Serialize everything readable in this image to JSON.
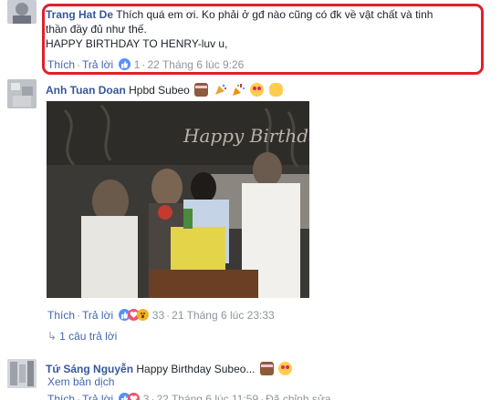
{
  "comment1": {
    "author": "Trang Hat De",
    "text_line1": "Thích quá em ơi. Ko phải ở gđ nào cũng có đk về vật chất và tinh",
    "text_line2": "thần đầy đủ như thế.",
    "text_line3": "HAPPY BIRTHDAY TO HENRY-luv u,",
    "like_label": "Thích",
    "reply_label": "Trả lời",
    "reaction_count": "1",
    "timestamp": "22 Tháng 6 lúc 9:26"
  },
  "comment2": {
    "author": "Anh Tuan Doan",
    "text": "Hpbd Subeo",
    "like_label": "Thích",
    "reply_label": "Trả lời",
    "reaction_count": "33",
    "timestamp": "21 Tháng 6 lúc 23:33",
    "photo_banner_text": "Happy Birthday",
    "replies_label": "1 câu trả lời"
  },
  "comment3": {
    "author": "Tứ Sáng Nguyễn",
    "text": "Happy Birthday Subeo...",
    "see_translation": "Xem bản dịch",
    "like_label": "Thích",
    "reply_label": "Trả lời",
    "reaction_count": "3",
    "timestamp": "22 Tháng 6 lúc 11:59",
    "edited_label": "Đã chỉnh sửa"
  },
  "icons": {
    "emoji": [
      "birthday-cake",
      "party-popper",
      "confetti",
      "heart-eyes-face",
      "raising-hands",
      "birthday-cake",
      "heart-eyes-face"
    ],
    "reactions": [
      "like",
      "love",
      "wow"
    ]
  },
  "colors": {
    "link": "#365899",
    "action_link": "#4267b2",
    "highlight_border": "#e0202a",
    "like": "#5890ff",
    "love": "#f25268",
    "wow": "#f7b125"
  }
}
